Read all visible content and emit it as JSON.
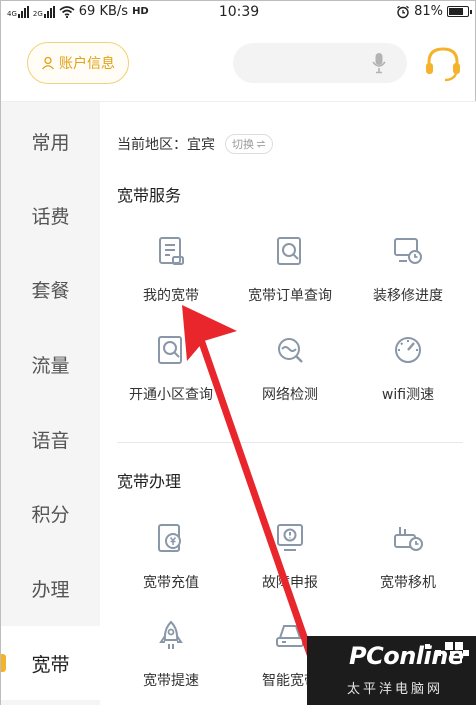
{
  "status_bar": {
    "network_small": "4G",
    "network_small2": "2G",
    "speed": "69 KB/s",
    "volte": "HD",
    "time": "10:39",
    "battery": "81%",
    "battery_level": 0.81
  },
  "header": {
    "account_label": "账户信息",
    "search_placeholder": ""
  },
  "sidebar": {
    "items": [
      {
        "label": "常用"
      },
      {
        "label": "话费"
      },
      {
        "label": "套餐"
      },
      {
        "label": "流量"
      },
      {
        "label": "语音"
      },
      {
        "label": "积分"
      },
      {
        "label": "办理"
      },
      {
        "label": "宽带"
      }
    ],
    "active_index": 7
  },
  "main": {
    "region_label": "当前地区：宜宾",
    "switch_label": "切换",
    "section1": {
      "title": "宽带服务",
      "items": [
        {
          "label": "我的宽带",
          "icon": "document-icon"
        },
        {
          "label": "宽带订单查询",
          "icon": "order-search-icon"
        },
        {
          "label": "装移修进度",
          "icon": "progress-clock-icon"
        },
        {
          "label": "开通小区查询",
          "icon": "community-search-icon"
        },
        {
          "label": "网络检测",
          "icon": "network-check-icon"
        },
        {
          "label": "wifi测速",
          "icon": "speedometer-icon"
        }
      ]
    },
    "section2": {
      "title": "宽带办理",
      "items": [
        {
          "label": "宽带充值",
          "icon": "recharge-icon"
        },
        {
          "label": "故障申报",
          "icon": "fault-report-icon"
        },
        {
          "label": "宽带移机",
          "icon": "relocate-icon"
        },
        {
          "label": "宽带提速",
          "icon": "rocket-icon"
        },
        {
          "label": "智能宽带",
          "icon": "router-icon"
        }
      ]
    }
  },
  "watermark": {
    "brand": "PConline",
    "sub": "太平洋电脑网"
  },
  "colors": {
    "accent": "#f5b32b",
    "account_text": "#e2a118",
    "arrow": "#e8262c",
    "icon_stroke": "#8a97a8"
  }
}
